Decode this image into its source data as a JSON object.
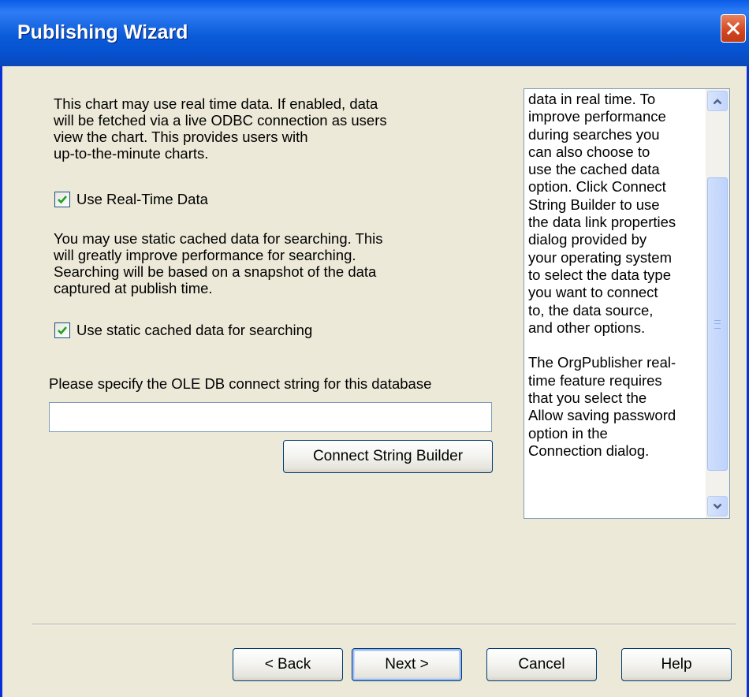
{
  "window": {
    "title": "Publishing Wizard"
  },
  "realtime": {
    "description": "This chart may use real time data.  If enabled, data\nwill be fetched via a live ODBC connection as users\nview the chart.  This provides users with\nup-to-the-minute charts.",
    "checkbox_label": "Use Real-Time Data",
    "checked": true
  },
  "cached": {
    "description": "You may use static cached data for searching.  This\nwill greatly improve performance for searching.\nSearching will be based on a snapshot of the data\ncaptured at publish time.",
    "checkbox_label": "Use static cached data for searching",
    "checked": true
  },
  "connection": {
    "label": "Please specify the OLE DB connect string for this database",
    "value": "",
    "builder_button": "Connect String Builder"
  },
  "help": {
    "text": "data in real time. To\nimprove performance\nduring searches you\ncan also choose to\nuse the cached data\noption. Click Connect\nString Builder to use\nthe data link properties\ndialog provided by\nyour operating system\nto select the data type\nyou want to connect\nto, the data source,\nand other options.\n\nThe OrgPublisher real-\ntime feature requires\nthat you select the\nAllow saving password\noption in the\nConnection dialog."
  },
  "footer": {
    "back": "< Back",
    "next": "Next >",
    "cancel": "Cancel",
    "help": "Help"
  },
  "icons": {
    "close": "close-icon",
    "check": "checkmark-icon",
    "scroll_up": "chevron-up-icon",
    "scroll_down": "chevron-down-icon"
  },
  "colors": {
    "titlebar": "#0a5ce8",
    "dialog_bg": "#ece9d8",
    "close_button": "#d2451f",
    "check_green": "#21a121"
  }
}
